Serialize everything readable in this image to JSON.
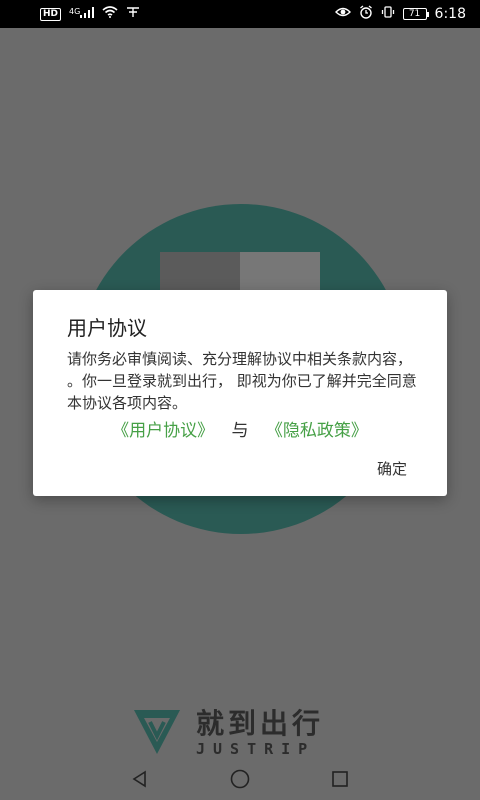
{
  "status_bar": {
    "hd": "HD",
    "network": "4G",
    "time": "6:18",
    "battery": "71"
  },
  "brand": {
    "name": "就到出行",
    "sub": "JUSTRIP",
    "color": "#2a5a54"
  },
  "dialog": {
    "title": "用户协议",
    "body": "请你务必审慎阅读、充分理解协议中相关条款内容， 。你一旦登录就到出行， 即视为你已了解并完全同意本协议各项内容。",
    "user_agreement_link": "《用户协议》",
    "and_text": "与",
    "privacy_policy_link": "《隐私政策》",
    "confirm_label": "确定",
    "link_color": "#46a046"
  },
  "nav_bar": {
    "icons": [
      "back-icon",
      "home-icon",
      "recents-icon"
    ]
  }
}
